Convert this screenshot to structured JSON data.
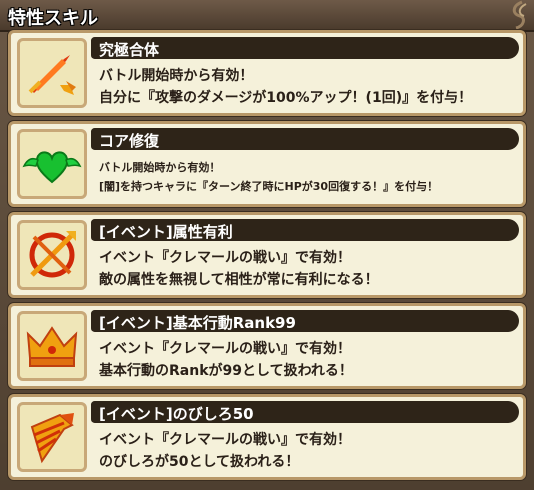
{
  "header": {
    "title": "特性スキル"
  },
  "skills": [
    {
      "icon": "sword-icon",
      "name": "究極合体",
      "lines": [
        "バトル開始時から有効！",
        "自分に『攻撃のダメージが100%アップ！(1回)』を付与！"
      ]
    },
    {
      "icon": "winged-heart-icon",
      "name": "コア修復",
      "lines": [
        "バトル開始時から有効！",
        "[闇]を持つキャラに『ターン終了時にHPが30回復する！』を付与！"
      ]
    },
    {
      "icon": "crossed-target-icon",
      "name": "[イベント]属性有利",
      "lines": [
        "イベント『クレマールの戦い』で有効！",
        "敵の属性を無視して相性が常に有利になる！"
      ]
    },
    {
      "icon": "crown-icon",
      "name": "[イベント]基本行動Rank99",
      "lines": [
        "イベント『クレマールの戦い』で有効！",
        "基本行動のRankが99として扱われる！"
      ]
    },
    {
      "icon": "drill-icon",
      "name": "[イベント]のびしろ50",
      "lines": [
        "イベント『クレマールの戦い』で有効！",
        "のびしろが50として扱われる！"
      ]
    }
  ]
}
